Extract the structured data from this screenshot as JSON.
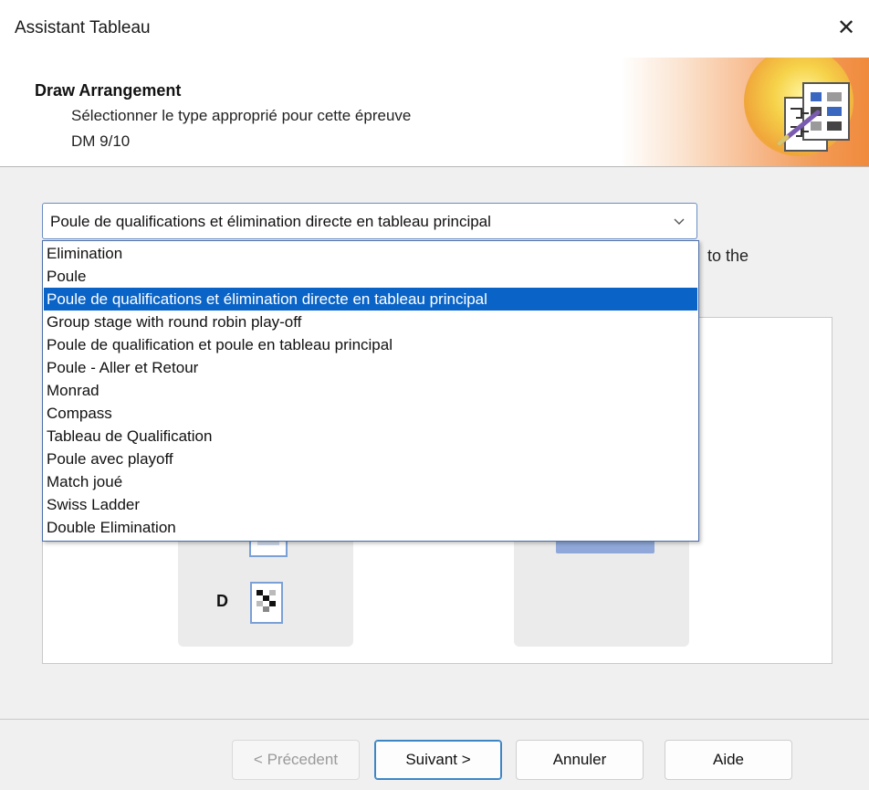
{
  "window": {
    "title": "Assistant Tableau",
    "close_label": "✕"
  },
  "header": {
    "title": "Draw Arrangement",
    "subtitle": "Sélectionner le type approprié pour cette épreuve",
    "event": "DM 9/10"
  },
  "combo": {
    "value": "Poule de qualifications et élimination directe en tableau principal"
  },
  "behind_text": "to the",
  "dropdown": {
    "selected_index": 2,
    "options": [
      "Elimination",
      "Poule",
      "Poule de qualifications et élimination directe en tableau principal",
      "Group stage with round robin play-off",
      "Poule de qualification et poule en tableau principal",
      "Poule - Aller et Retour",
      "Monrad",
      "Compass",
      "Tableau de Qualification",
      "Poule avec playoff",
      "Match joué",
      "Swiss Ladder",
      "Double Elimination"
    ]
  },
  "preview": {
    "card_letter": "D"
  },
  "buttons": {
    "previous": "< Précedent",
    "next": "Suivant >",
    "cancel": "Annuler",
    "help": "Aide"
  },
  "colors": {
    "selection": "#0a64c8",
    "focus_border": "#3d86c6",
    "banner_orange": "#f08a3c"
  }
}
